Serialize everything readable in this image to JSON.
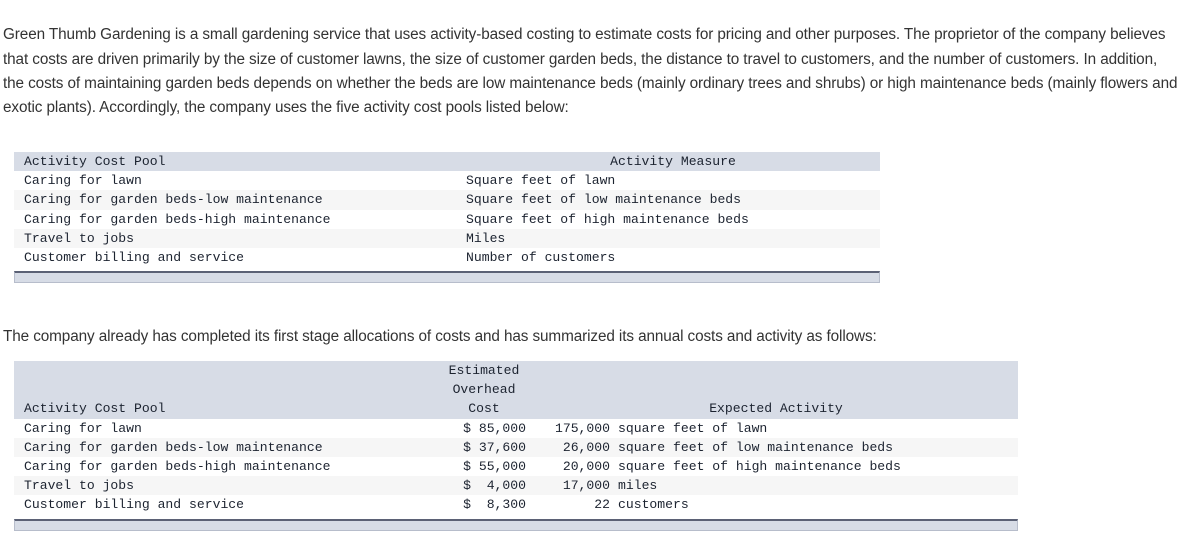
{
  "intro_paragraph": "Green Thumb Gardening is a small gardening service that uses activity-based costing to estimate costs for pricing and other purposes. The proprietor of the company believes that costs are driven primarily by the size of customer lawns, the size of customer garden beds, the distance to travel to customers, and the number of customers. In addition, the costs of maintaining garden beds depends on whether the beds are low maintenance beds (mainly ordinary trees and shrubs) or high maintenance beds (mainly flowers and exotic plants). Accordingly, the company uses the five activity cost pools listed below:",
  "second_paragraph": "The company already has completed its first stage allocations of costs and has summarized its annual costs and activity as follows:",
  "colors": {
    "header_band": "#d7dce6",
    "row_alt": "#f6f6f6",
    "row_base": "#ffffff",
    "footer_border": "#5b6175",
    "text": "#1c2330",
    "paragraph_text": "#333333"
  },
  "table_activity_measures": {
    "headers": {
      "pool": "Activity Cost Pool",
      "measure": "Activity Measure"
    },
    "rows": [
      {
        "pool": "Caring for lawn",
        "measure": "Square feet of lawn"
      },
      {
        "pool": "Caring for garden beds-low maintenance",
        "measure": "Square feet of low maintenance beds"
      },
      {
        "pool": "Caring for garden beds-high maintenance",
        "measure": "Square feet of high maintenance beds"
      },
      {
        "pool": "Travel to jobs",
        "measure": "Miles"
      },
      {
        "pool": "Customer billing and service",
        "measure": "Number of customers"
      }
    ]
  },
  "table_cost_summary": {
    "headers": {
      "pool": "Activity Cost Pool",
      "cost_line1": "Estimated",
      "cost_line2": "Overhead",
      "cost_line3": "Cost",
      "expected_activity": "Expected Activity"
    },
    "rows": [
      {
        "pool": "Caring for lawn",
        "cost": "$ 85,000",
        "qty": "175,000",
        "uom": "square feet of lawn"
      },
      {
        "pool": "Caring for garden beds-low maintenance",
        "cost": "$ 37,600",
        "qty": "26,000",
        "uom": "square feet of low maintenance beds"
      },
      {
        "pool": "Caring for garden beds-high maintenance",
        "cost": "$ 55,000",
        "qty": "20,000",
        "uom": "square feet of high maintenance beds"
      },
      {
        "pool": "Travel to jobs",
        "cost": "$  4,000",
        "qty": "17,000",
        "uom": "miles"
      },
      {
        "pool": "Customer billing and service",
        "cost": "$  8,300",
        "qty": "22",
        "uom": "customers"
      }
    ]
  }
}
